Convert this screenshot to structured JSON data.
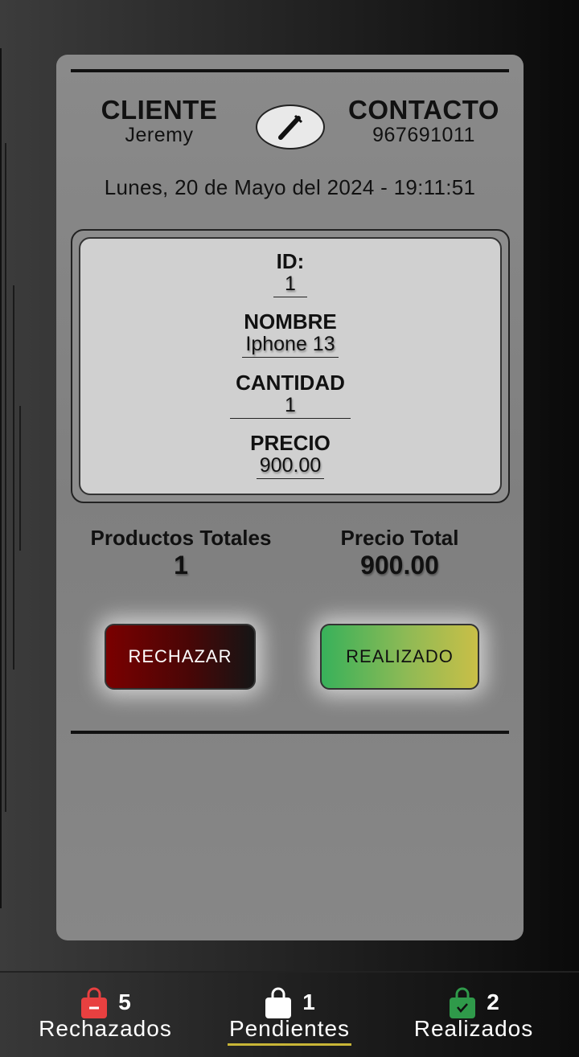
{
  "order": {
    "client_label": "CLIENTE",
    "client_name": "Jeremy",
    "contact_label": "CONTACTO",
    "contact_phone": "967691011",
    "datetime": "Lunes, 20 de Mayo del 2024 - 19:11:51",
    "product": {
      "id_label": "ID:",
      "id_value": "1",
      "name_label": "NOMBRE",
      "name_value": "Iphone 13",
      "qty_label": "CANTIDAD",
      "qty_value": "1",
      "price_label": "PRECIO",
      "price_value": "900.00"
    },
    "totals": {
      "products_label": "Productos Totales",
      "products_value": "1",
      "price_label": "Precio Total",
      "price_value": "900.00"
    },
    "actions": {
      "reject_label": "RECHAZAR",
      "done_label": "REALIZADO"
    }
  },
  "nav": {
    "rejected": {
      "label": "Rechazados",
      "count": "5",
      "icon": "bag-minus-icon",
      "color": "#e84040"
    },
    "pending": {
      "label": "Pendientes",
      "count": "1",
      "icon": "bag-icon",
      "color": "#ffffff",
      "active": true
    },
    "done": {
      "label": "Realizados",
      "count": "2",
      "icon": "bag-check-icon",
      "color": "#2f9a4a"
    }
  }
}
